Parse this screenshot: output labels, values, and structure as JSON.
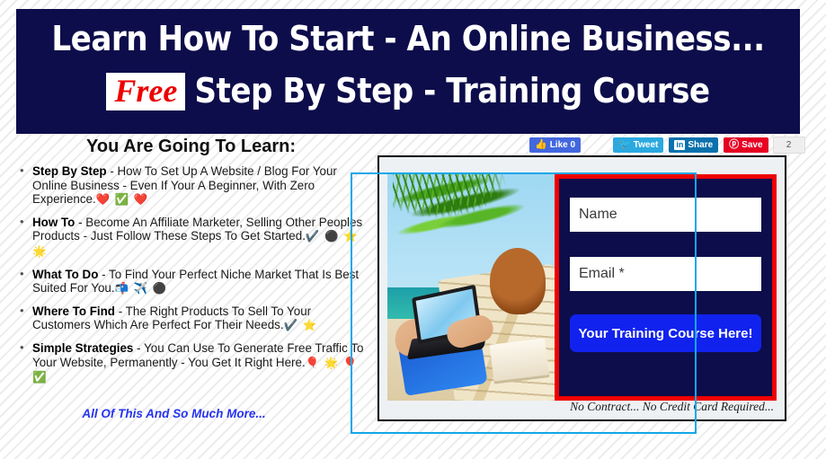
{
  "header": {
    "line1": "Learn How To Start - An Online Business...",
    "free_badge": "Free",
    "line2_rest": "Step By Step - Training Course"
  },
  "left": {
    "heading": "You Are Going To Learn:",
    "bullets": [
      {
        "term": "Step By Step",
        "text": " - How To Set Up A Website / Blog For Your Online Business - Even If Your A Beginner, With Zero Experience.",
        "icons": "❤️ ✅ ❤️"
      },
      {
        "term": "How To",
        "text": " - Become An Affiliate Marketer, Selling Other Peoples Products - Just Follow These Steps To Get Started.",
        "icons": "✔️ ⚫ ⭐ 🌟"
      },
      {
        "term": "What To Do",
        "text": " - To Find Your Perfect Niche Market That Is Best Suited For You.",
        "icons": "📬 ✈️ ⚫"
      },
      {
        "term": "Where To Find",
        "text": " - The Right Products To Sell To Your Customers Which Are Perfect For Their Needs.",
        "icons": "✔️ ⭐"
      },
      {
        "term": "Simple Strategies",
        "text": " - You Can Use To Generate Free Traffic To Your Website, Permanently - You Get It Right Here.",
        "icons": "🎈 🌟 🎈 ✅"
      }
    ],
    "more_link": "All Of This And So Much More..."
  },
  "social": {
    "like_label": "Like 0",
    "like_icon": "thumbs-up-icon",
    "tweet_label": "Tweet",
    "tweet_icon": "twitter-bird-icon",
    "share_label": "Share",
    "share_icon": "linkedin-icon",
    "share_glyph": "in",
    "save_label": "Save",
    "save_icon": "pinterest-icon",
    "save_count": "2"
  },
  "optin": {
    "name_placeholder": "Name",
    "email_placeholder": "Email *",
    "name_value": "",
    "email_value": "",
    "submit_label": "Your Training Course Here!",
    "disclaimer": "No Contract... No Credit Card Required..."
  },
  "colors": {
    "navy": "#0d0d4b",
    "red": "#ee0000",
    "blue_button": "#1122ee",
    "link_blue": "#2633ee",
    "selection_cyan": "#12a7e8",
    "panel_bg": "#eef1f4"
  }
}
